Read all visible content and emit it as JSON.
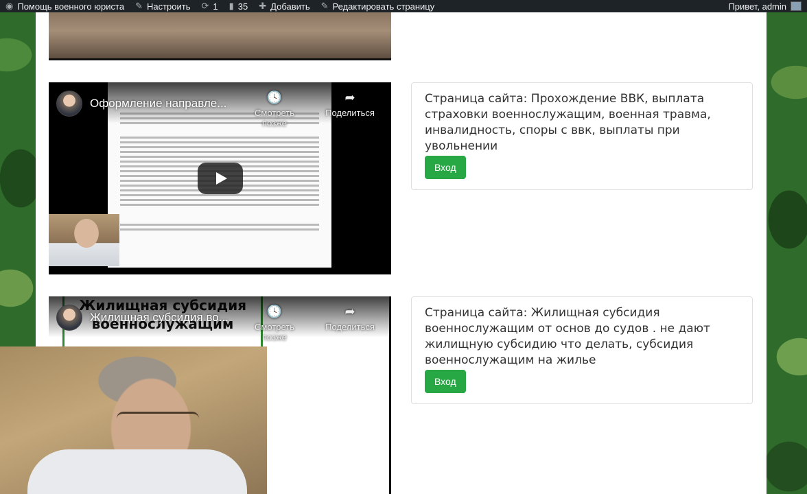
{
  "admin_bar": {
    "site_name": "Помощь военного юриста",
    "customize": "Настроить",
    "updates_count": "1",
    "comments_count": "35",
    "new_label": "Добавить",
    "edit_label": "Редактировать страницу",
    "greeting": "Привет, admin"
  },
  "videos": [
    {
      "title": "Оформление направле...",
      "watch_later": "Смотреть позже",
      "share": "Поделиться"
    },
    {
      "title": "Жилищная субсидия во...",
      "watch_later": "Смотреть позже",
      "share": "Поделиться",
      "thumbnail_text": "Жилищная субсидия военнослужащим"
    }
  ],
  "cards": [
    {
      "text": "Страница сайта: Прохождение ВВК, выплата страховки военнослужащим, военная травма, инвалидность, споры с ввк, выплаты при увольнении",
      "button": "Вход"
    },
    {
      "text": "Страница сайта: Жилищная субсидия военнослужащим от основ до судов . не дают жилищную субсидию что делать, субсидия военнослужащим на жилье",
      "button": "Вход"
    }
  ],
  "colors": {
    "admin_bar_bg": "#1d2327",
    "button_green": "#28a745",
    "page_bg": "#ffffff"
  }
}
